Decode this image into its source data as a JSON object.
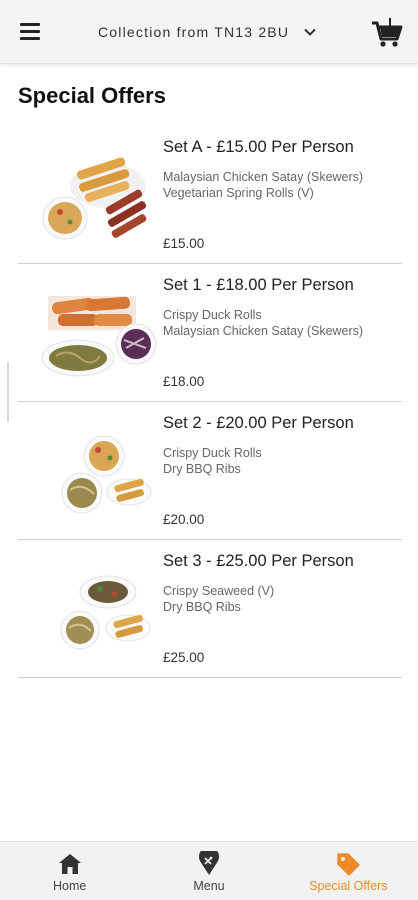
{
  "header": {
    "collection_text": "Collection from TN13 2BU",
    "menu_icon": "hamburger-menu-icon",
    "dropdown_icon": "chevron-down-icon",
    "cart_icon": "shopping-cart-icon"
  },
  "page": {
    "title": "Special Offers"
  },
  "offers": [
    {
      "title": "Set A - £15.00 Per Person",
      "items": [
        "Malaysian Chicken Satay (Skewers)",
        "Vegetarian Spring Rolls (V)"
      ],
      "price": "£15.00"
    },
    {
      "title": "Set 1 - £18.00 Per Person",
      "items": [
        "Crispy Duck Rolls",
        "Malaysian Chicken Satay (Skewers)"
      ],
      "price": "£18.00"
    },
    {
      "title": "Set 2 - £20.00 Per Person",
      "items": [
        "Crispy Duck Rolls",
        "Dry BBQ Ribs"
      ],
      "price": "£20.00"
    },
    {
      "title": "Set 3 - £25.00 Per Person",
      "items": [
        "Crispy Seaweed (V)",
        "Dry BBQ Ribs"
      ],
      "price": "£25.00"
    }
  ],
  "bottom_nav": {
    "items": [
      {
        "label": "Home",
        "icon": "home-icon",
        "active": false
      },
      {
        "label": "Menu",
        "icon": "menu-pin-icon",
        "active": false
      },
      {
        "label": "Special Offers",
        "icon": "tag-icon",
        "active": true
      }
    ]
  },
  "colors": {
    "accent": "#ef8a2a",
    "header_bg": "#f4f4f4",
    "nav_bg": "#f2f2f2",
    "divider": "#cfcfcf"
  }
}
